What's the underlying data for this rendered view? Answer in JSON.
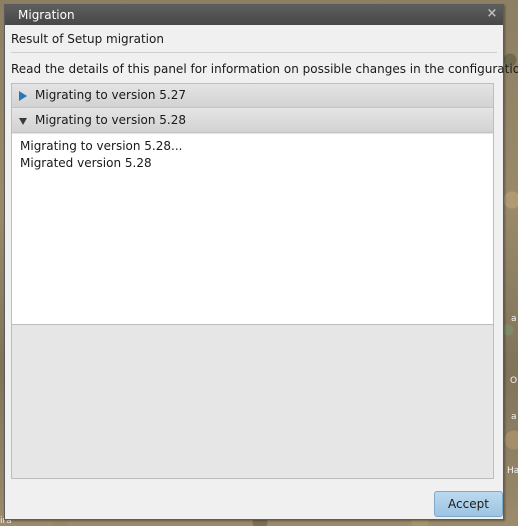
{
  "window": {
    "title": "Migration",
    "close_symbol": "×",
    "subtitle": "Result of Setup migration",
    "info": "Read the details of this panel for information on possible changes in the configuration"
  },
  "accordion": {
    "sections": [
      {
        "label": "Migrating to version 5.27",
        "expanded": false,
        "arrow_icon": "triangle-right-icon"
      },
      {
        "label": "Migrating to version 5.28",
        "expanded": true,
        "arrow_icon": "triangle-down-icon"
      }
    ],
    "content_lines": [
      "Migrating to version 5.28...",
      "Migrated version 5.28"
    ]
  },
  "buttons": {
    "accept_label": "Accept"
  },
  "colors": {
    "titlebar": "#4e4e4e",
    "accent_arrow": "#2a76b8",
    "accept_button": "#a9cde8"
  },
  "background": {
    "map_labels": [
      "a",
      "O",
      "a",
      "Ha",
      "ira"
    ]
  }
}
